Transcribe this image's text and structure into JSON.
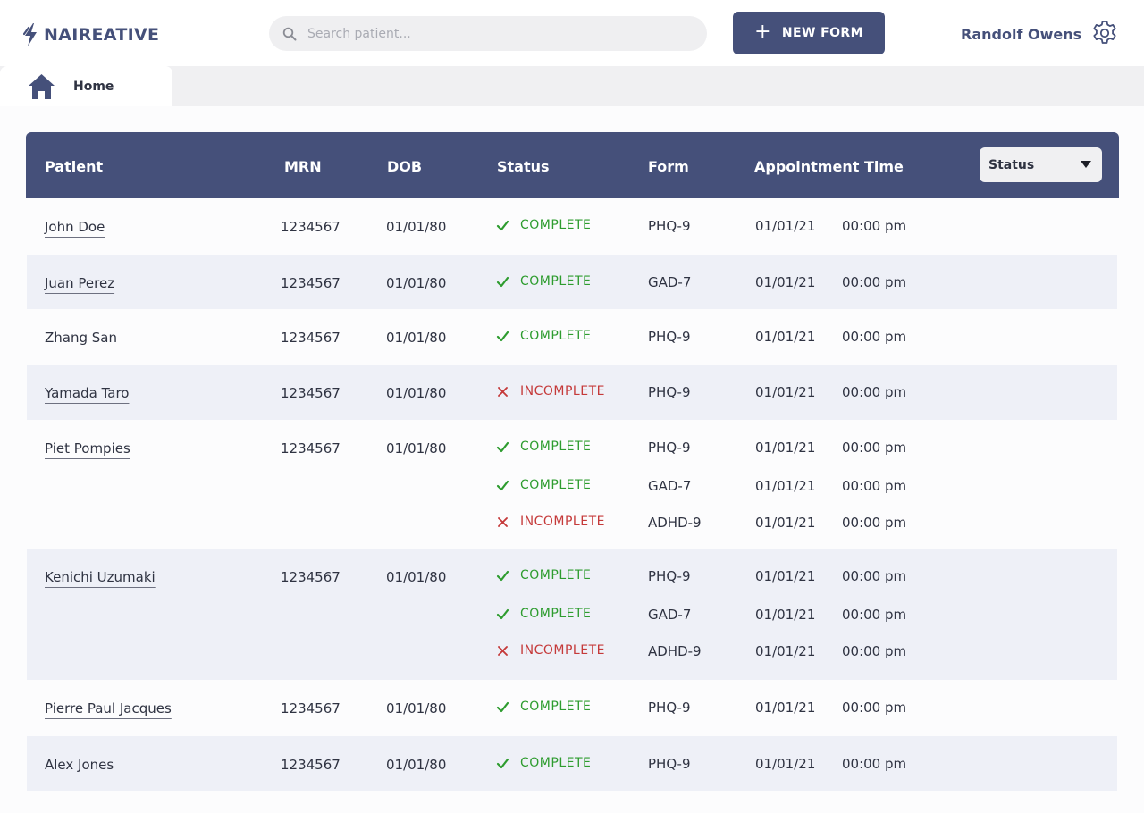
{
  "app": {
    "brand": "NAIREATIVE",
    "brand_color": "#45507a",
    "search_placeholder": "Search patient...",
    "new_form_label": "NEW FORM",
    "user_name": "Randolf Owens"
  },
  "tabs": [
    {
      "label": "Home",
      "icon": "home-icon"
    }
  ],
  "table": {
    "headers": {
      "patient": "Patient",
      "mrn": "MRN",
      "dob": "DOB",
      "status": "Status",
      "form": "Form",
      "appointment": "Appointment Time"
    },
    "filter_label": "Status",
    "rows": [
      {
        "name": "John Doe",
        "mrn": "1234567",
        "dob": "01/01/80",
        "forms": [
          {
            "status": "COMPLETE",
            "form": "PHQ-9",
            "date": "01/01/21",
            "time": "00:00 pm"
          }
        ]
      },
      {
        "name": "Juan Perez",
        "mrn": "1234567",
        "dob": "01/01/80",
        "forms": [
          {
            "status": "COMPLETE",
            "form": "GAD-7",
            "date": "01/01/21",
            "time": "00:00 pm"
          }
        ]
      },
      {
        "name": "Zhang San",
        "mrn": "1234567",
        "dob": "01/01/80",
        "forms": [
          {
            "status": "COMPLETE",
            "form": "PHQ-9",
            "date": "01/01/21",
            "time": "00:00 pm"
          }
        ]
      },
      {
        "name": "Yamada Taro",
        "mrn": "1234567",
        "dob": "01/01/80",
        "forms": [
          {
            "status": "INCOMPLETE",
            "form": "PHQ-9",
            "date": "01/01/21",
            "time": "00:00 pm"
          }
        ]
      },
      {
        "name": "Piet Pompies",
        "mrn": "1234567",
        "dob": "01/01/80",
        "forms": [
          {
            "status": "COMPLETE",
            "form": "PHQ-9",
            "date": "01/01/21",
            "time": "00:00 pm"
          },
          {
            "status": "COMPLETE",
            "form": "GAD-7",
            "date": "01/01/21",
            "time": "00:00 pm"
          },
          {
            "status": "INCOMPLETE",
            "form": "ADHD-9",
            "date": "01/01/21",
            "time": "00:00 pm"
          }
        ]
      },
      {
        "name": "Kenichi Uzumaki",
        "mrn": "1234567",
        "dob": "01/01/80",
        "forms": [
          {
            "status": "COMPLETE",
            "form": "PHQ-9",
            "date": "01/01/21",
            "time": "00:00 pm"
          },
          {
            "status": "COMPLETE",
            "form": "GAD-7",
            "date": "01/01/21",
            "time": "00:00 pm"
          },
          {
            "status": "INCOMPLETE",
            "form": "ADHD-9",
            "date": "01/01/21",
            "time": "00:00 pm"
          }
        ]
      },
      {
        "name": "Pierre Paul Jacques",
        "mrn": "1234567",
        "dob": "01/01/80",
        "forms": [
          {
            "status": "COMPLETE",
            "form": "PHQ-9",
            "date": "01/01/21",
            "time": "00:00 pm"
          }
        ]
      },
      {
        "name": "Alex Jones",
        "mrn": "1234567",
        "dob": "01/01/80",
        "forms": [
          {
            "status": "COMPLETE",
            "form": "PHQ-9",
            "date": "01/01/21",
            "time": "00:00 pm"
          }
        ]
      }
    ]
  },
  "colors": {
    "header_bg": "#45507a",
    "complete": "#2e9c2f",
    "incomplete": "#c53a3a",
    "alt_row": "#eef0f7"
  }
}
